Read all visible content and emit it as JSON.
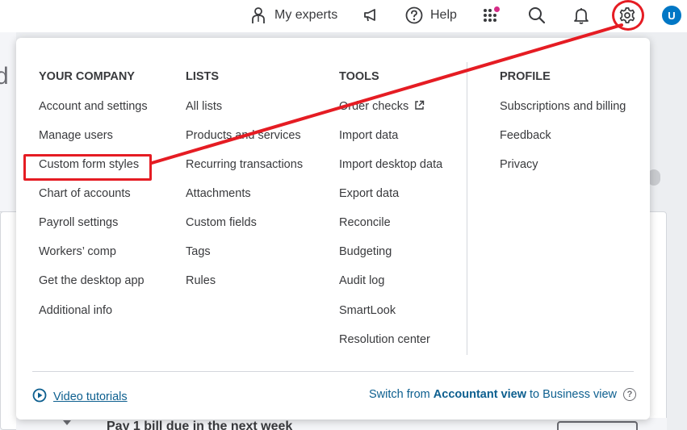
{
  "topbar": {
    "my_experts_label": "My experts",
    "help_label": "Help",
    "avatar_initial": "U"
  },
  "background": {
    "heading_fragment": "d l",
    "card_text": "Pay 1 bill due in the next week"
  },
  "menu": {
    "columns": [
      {
        "title": "YOUR COMPANY",
        "items": [
          "Account and settings",
          "Manage users",
          "Custom form styles",
          "Chart of accounts",
          "Payroll settings",
          "Workers’ comp",
          "Get the desktop app",
          "Additional info"
        ]
      },
      {
        "title": "LISTS",
        "items": [
          "All lists",
          "Products and services",
          "Recurring transactions",
          "Attachments",
          "Custom fields",
          "Tags",
          "Rules"
        ]
      },
      {
        "title": "TOOLS",
        "items": [
          "Order checks",
          "Import data",
          "Import desktop data",
          "Export data",
          "Reconcile",
          "Budgeting",
          "Audit log",
          "SmartLook",
          "Resolution center"
        ]
      },
      {
        "title": "PROFILE",
        "items": [
          "Subscriptions and billing",
          "Feedback",
          "Privacy"
        ]
      }
    ],
    "footer": {
      "video_tutorials": "Video tutorials",
      "switch_prefix": "Switch from",
      "switch_from": "Accountant view",
      "switch_to_word": "to",
      "switch_to": "Business view"
    }
  },
  "colors": {
    "link": "#0d5f8f",
    "annotation": "#e51c23",
    "avatar": "#0077c5",
    "notification_dot": "#d52b86"
  },
  "icons": [
    "my-experts-icon",
    "announcement-icon",
    "help-icon",
    "apps-grid-icon",
    "search-icon",
    "bell-icon",
    "gear-icon",
    "external-link-icon",
    "play-circle-icon",
    "question-icon"
  ]
}
